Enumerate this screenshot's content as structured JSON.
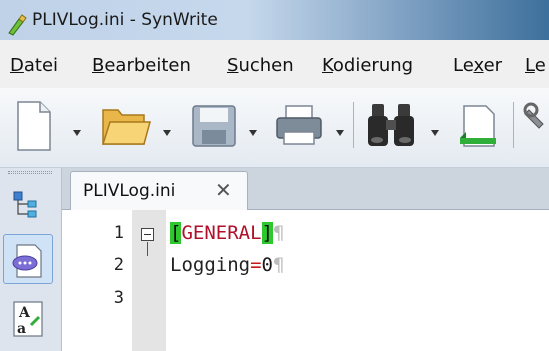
{
  "window": {
    "title": "PLIVLog.ini - SynWrite"
  },
  "menu": [
    {
      "mnemonic": "D",
      "rest": "atei"
    },
    {
      "mnemonic": "B",
      "rest": "earbeiten"
    },
    {
      "mnemonic": "S",
      "rest": "uchen"
    },
    {
      "mnemonic": "K",
      "rest": "odierung"
    },
    {
      "pre": "Le",
      "mnemonic": "x",
      "rest": "er"
    },
    {
      "mnemonic": "L",
      "rest": "e"
    }
  ],
  "toolbar": {
    "buttons": [
      "new-file-icon",
      "open-folder-icon",
      "save-disk-icon",
      "print-icon",
      "find-binoculars-icon",
      "document-bookmark-icon",
      "tools-icon"
    ]
  },
  "left_panel": {
    "buttons": [
      "tree-icon",
      "clip-icon",
      "spelling-icon"
    ]
  },
  "tabs": [
    {
      "label": "PLIVLog.ini",
      "close": "✕"
    }
  ],
  "editor": {
    "line_numbers": [
      "1",
      "2",
      "3"
    ],
    "line1": {
      "open": "[",
      "section": "GENERAL",
      "close": "]",
      "pilcrow": "¶"
    },
    "line2": {
      "key": "Logging",
      "eq": "=",
      "value": "0",
      "pilcrow": "¶"
    }
  }
}
